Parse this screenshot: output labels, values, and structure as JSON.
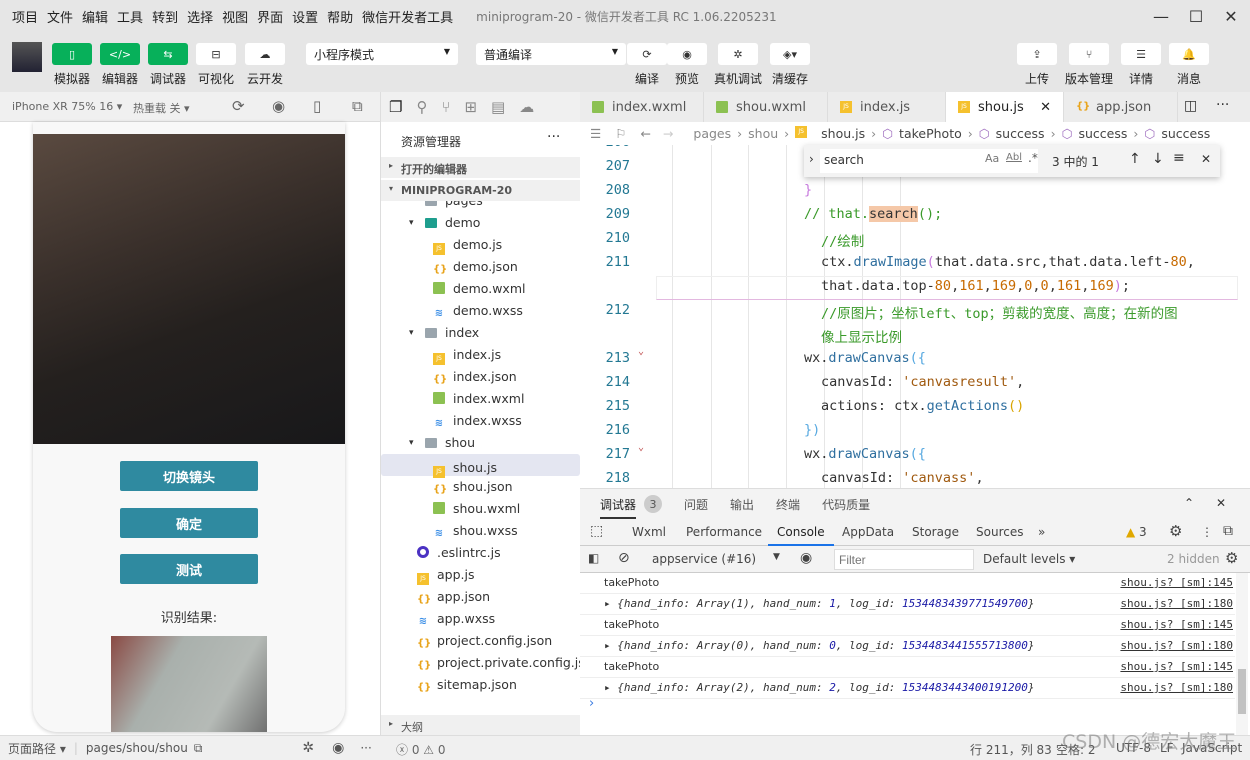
{
  "titlebar": {
    "menus": [
      "项目",
      "文件",
      "编辑",
      "工具",
      "转到",
      "选择",
      "视图",
      "界面",
      "设置",
      "帮助",
      "微信开发者工具"
    ],
    "window_title": "miniprogram-20 - 微信开发者工具 RC 1.06.2205231"
  },
  "toolbar": {
    "left": [
      {
        "label": "模拟器",
        "icon": "phone-icon"
      },
      {
        "label": "编辑器",
        "icon": "code-icon"
      },
      {
        "label": "调试器",
        "icon": "sliders-icon"
      },
      {
        "label": "可视化",
        "icon": "layout-icon"
      },
      {
        "label": "云开发",
        "icon": "cloud-icon"
      }
    ],
    "mode_select": "小程序模式",
    "compile_select": "普通编译",
    "mid": [
      {
        "label": "编译",
        "icon": "refresh-icon"
      },
      {
        "label": "预览",
        "icon": "eye-icon"
      },
      {
        "label": "真机调试",
        "icon": "bug-icon"
      },
      {
        "label": "清缓存",
        "icon": "layers-icon"
      }
    ],
    "right": [
      {
        "label": "上传",
        "icon": "upload-icon"
      },
      {
        "label": "版本管理",
        "icon": "branch-icon"
      },
      {
        "label": "详情",
        "icon": "menu-icon"
      },
      {
        "label": "消息",
        "icon": "bell-icon"
      }
    ],
    "accent": "#07b05a"
  },
  "simulator": {
    "device": "iPhone XR 75% 16 ▾",
    "hotreload": "热重载 关 ▾",
    "buttons": [
      "切换镜头",
      "确定",
      "测试"
    ],
    "result_label": "识别结果:",
    "button_color": "#2f8aa0"
  },
  "sim_status": {
    "path_label": "页面路径 ▾",
    "path": "pages/shou/shou"
  },
  "explorer": {
    "title": "资源管理器",
    "open_editors": "打开的编辑器",
    "project": "MINIPROGRAM-20",
    "outline": "大纲",
    "tree": [
      {
        "label": "pages",
        "icon": "folder",
        "depth": 1
      },
      {
        "label": "demo",
        "icon": "folder-teal",
        "depth": 1,
        "arrow": "▾"
      },
      {
        "label": "demo.js",
        "icon": "js",
        "depth": 2
      },
      {
        "label": "demo.json",
        "icon": "json",
        "depth": 2
      },
      {
        "label": "demo.wxml",
        "icon": "wxml",
        "depth": 2
      },
      {
        "label": "demo.wxss",
        "icon": "wxss",
        "depth": 2
      },
      {
        "label": "index",
        "icon": "folder",
        "depth": 1,
        "arrow": "▾"
      },
      {
        "label": "index.js",
        "icon": "js",
        "depth": 2
      },
      {
        "label": "index.json",
        "icon": "json",
        "depth": 2
      },
      {
        "label": "index.wxml",
        "icon": "wxml",
        "depth": 2
      },
      {
        "label": "index.wxss",
        "icon": "wxss",
        "depth": 2
      },
      {
        "label": "shou",
        "icon": "folder",
        "depth": 1,
        "arrow": "▾"
      },
      {
        "label": "shou.js",
        "icon": "js",
        "depth": 2,
        "selected": true
      },
      {
        "label": "shou.json",
        "icon": "json",
        "depth": 2
      },
      {
        "label": "shou.wxml",
        "icon": "wxml",
        "depth": 2
      },
      {
        "label": "shou.wxss",
        "icon": "wxss",
        "depth": 2
      },
      {
        "label": ".eslintrc.js",
        "icon": "eslint",
        "depth": 0
      },
      {
        "label": "app.js",
        "icon": "js",
        "depth": 0
      },
      {
        "label": "app.json",
        "icon": "json",
        "depth": 0
      },
      {
        "label": "app.wxss",
        "icon": "wxss",
        "depth": 0
      },
      {
        "label": "project.config.json",
        "icon": "json",
        "depth": 0
      },
      {
        "label": "project.private.config.js...",
        "icon": "json",
        "depth": 0
      },
      {
        "label": "sitemap.json",
        "icon": "json",
        "depth": 0
      }
    ],
    "status_errors": "0",
    "status_warnings": "0"
  },
  "editor": {
    "tabs": [
      {
        "label": "index.wxml",
        "icon": "wxml"
      },
      {
        "label": "shou.wxml",
        "icon": "wxml"
      },
      {
        "label": "index.js",
        "icon": "js"
      },
      {
        "label": "shou.js",
        "icon": "js",
        "active": true
      },
      {
        "label": "app.json",
        "icon": "json"
      }
    ],
    "breadcrumbs": [
      "pages",
      "shou",
      "shou.js",
      "takePhoto",
      "success",
      "success",
      "success"
    ],
    "find": {
      "value": "search",
      "result": "3 中的 1"
    },
    "lines": [
      {
        "n": "206",
        "tokens": []
      },
      {
        "n": "207",
        "tokens": []
      },
      {
        "n": "208",
        "indent": 0,
        "tokens": [
          {
            "t": "br1",
            "s": "}"
          }
        ]
      },
      {
        "n": "209",
        "indent": 0,
        "tokens": [
          {
            "t": "cm",
            "s": "// that."
          },
          {
            "t": "hl",
            "s": "search"
          },
          {
            "t": "cm",
            "s": "();"
          }
        ]
      },
      {
        "n": "210",
        "indent": 1,
        "tokens": [
          {
            "t": "cm",
            "s": "//绘制"
          }
        ]
      },
      {
        "n": "211",
        "indent": 1,
        "tokens": [
          {
            "t": "",
            "s": "ctx."
          },
          {
            "t": "fn",
            "s": "drawImage"
          },
          {
            "t": "br1",
            "s": "("
          },
          {
            "t": "",
            "s": "that.data.src,that.data.left-"
          },
          {
            "t": "num",
            "s": "80"
          },
          {
            "t": "",
            "s": ","
          }
        ]
      },
      {
        "n": "",
        "indent": 1,
        "tokens": [
          {
            "t": "",
            "s": "that.data.top-"
          },
          {
            "t": "num",
            "s": "80"
          },
          {
            "t": "",
            "s": ","
          },
          {
            "t": "num",
            "s": "161"
          },
          {
            "t": "",
            "s": ","
          },
          {
            "t": "num",
            "s": "169"
          },
          {
            "t": "",
            "s": ","
          },
          {
            "t": "num",
            "s": "0"
          },
          {
            "t": "",
            "s": ","
          },
          {
            "t": "num",
            "s": "0"
          },
          {
            "t": "",
            "s": ","
          },
          {
            "t": "num",
            "s": "161"
          },
          {
            "t": "",
            "s": ","
          },
          {
            "t": "num",
            "s": "169"
          },
          {
            "t": "br1",
            "s": ")"
          },
          {
            "t": "",
            "s": ";"
          }
        ]
      },
      {
        "n": "212",
        "indent": 1,
        "tokens": [
          {
            "t": "cm",
            "s": "//原图片；坐标left、top；剪裁的宽度、高度；在新的图"
          }
        ]
      },
      {
        "n": "",
        "indent": 1,
        "tokens": [
          {
            "t": "cm",
            "s": "像上显示比例"
          }
        ]
      },
      {
        "n": "213",
        "indent": 0,
        "fold": true,
        "tokens": [
          {
            "t": "",
            "s": "wx."
          },
          {
            "t": "fn",
            "s": "drawCanvas"
          },
          {
            "t": "br2",
            "s": "({"
          }
        ]
      },
      {
        "n": "214",
        "indent": 1,
        "tokens": [
          {
            "t": "",
            "s": "canvasId: "
          },
          {
            "t": "str",
            "s": "'canvasresult'"
          },
          {
            "t": "",
            "s": ","
          }
        ]
      },
      {
        "n": "215",
        "indent": 1,
        "tokens": [
          {
            "t": "",
            "s": "actions: ctx."
          },
          {
            "t": "fn",
            "s": "getActions"
          },
          {
            "t": "br3",
            "s": "()"
          }
        ]
      },
      {
        "n": "216",
        "indent": 0,
        "tokens": [
          {
            "t": "br2",
            "s": "})"
          }
        ]
      },
      {
        "n": "217",
        "indent": 0,
        "fold": true,
        "tokens": [
          {
            "t": "",
            "s": "wx."
          },
          {
            "t": "fn",
            "s": "drawCanvas"
          },
          {
            "t": "br2",
            "s": "({"
          }
        ]
      },
      {
        "n": "218",
        "indent": 1,
        "tokens": [
          {
            "t": "",
            "s": "canvasId: "
          },
          {
            "t": "str",
            "s": "'canvass'"
          },
          {
            "t": "",
            "s": ","
          }
        ]
      }
    ]
  },
  "devtools": {
    "tabs": [
      "调试器",
      "问题",
      "输出",
      "终端",
      "代码质量"
    ],
    "badge": "3",
    "panels": [
      "Wxml",
      "Performance",
      "Console",
      "AppData",
      "Storage",
      "Sources"
    ],
    "active_panel": "Console",
    "warnings": "3",
    "context": "appservice (#16)",
    "filter_placeholder": "Filter",
    "levels": "Default levels ▾",
    "hidden": "2 hidden",
    "messages": [
      {
        "text": "takePhoto",
        "src": "shou.js? [sm]:145"
      },
      {
        "obj": true,
        "count": "1",
        "num": "1",
        "log_id": "1534483439771549700",
        "src": "shou.js? [sm]:180"
      },
      {
        "text": "takePhoto",
        "src": "shou.js? [sm]:145"
      },
      {
        "obj": true,
        "count": "0",
        "num": "0",
        "log_id": "1534483441555713800",
        "src": "shou.js? [sm]:180"
      },
      {
        "text": "takePhoto",
        "src": "shou.js? [sm]:145"
      },
      {
        "obj": true,
        "count": "2",
        "num": "2",
        "log_id": "1534483443400191200",
        "src": "shou.js? [sm]:180"
      }
    ]
  },
  "statusbar": {
    "position": "行 211，列 83",
    "spaces": "空格: 2",
    "encoding": "UTF-8",
    "eol": "LF",
    "language": "JavaScript"
  },
  "watermark": "CSDN @德宏大魔王"
}
